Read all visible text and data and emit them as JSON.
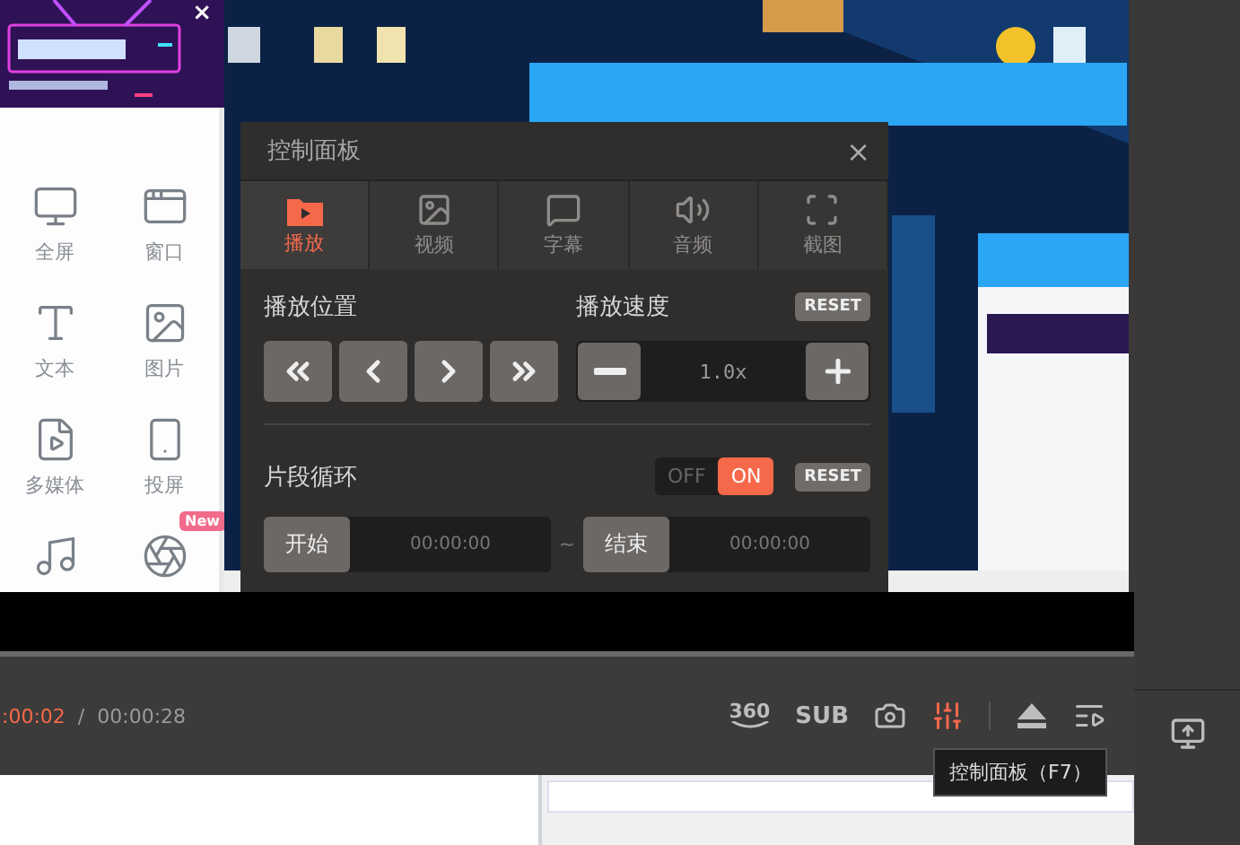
{
  "sidebar": {
    "close": "×",
    "items": [
      {
        "label": "全屏"
      },
      {
        "label": "窗口"
      },
      {
        "label": "文本"
      },
      {
        "label": "图片"
      },
      {
        "label": "多媒体"
      },
      {
        "label": "投屏"
      }
    ],
    "new_badge": "New"
  },
  "control_panel": {
    "title": "控制面板",
    "close": "×",
    "tabs": [
      {
        "label": "播放",
        "selected": true
      },
      {
        "label": "视频",
        "selected": false
      },
      {
        "label": "字幕",
        "selected": false
      },
      {
        "label": "音频",
        "selected": false
      },
      {
        "label": "截图",
        "selected": false
      }
    ],
    "position": {
      "label": "播放位置"
    },
    "speed": {
      "label": "播放速度",
      "reset": "RESET",
      "value": "1.0x"
    },
    "loop": {
      "label": "片段循环",
      "on": true,
      "off_label": "OFF",
      "on_label": "ON",
      "reset": "RESET",
      "start_label": "开始",
      "start_time": "00:00:00",
      "separator": "~",
      "end_label": "结束",
      "end_time": "00:00:00"
    }
  },
  "player_bar": {
    "current_time": ":00:02",
    "separator": "/",
    "total_time": "00:00:28",
    "controls": [
      {
        "kind": "vr",
        "label": "360",
        "active": false
      },
      {
        "kind": "subtitle",
        "label": "SUB",
        "active": false
      },
      {
        "kind": "camera",
        "active": false
      },
      {
        "kind": "mixer",
        "active": true
      },
      {
        "kind": "eject",
        "active": false
      },
      {
        "kind": "playlist",
        "active": false
      }
    ],
    "tooltip": "控制面板（F7）"
  }
}
